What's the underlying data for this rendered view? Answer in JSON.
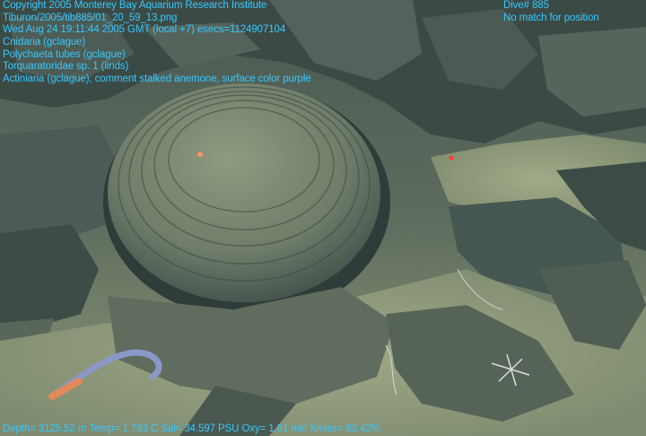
{
  "overlay": {
    "header_lines": [
      "Copyright 2005 Monterey Bay Aquarium Research Institute",
      "Tiburon/2005/tib885/01_20_59_13.png",
      "Wed Aug 24 19:11:44 2005 GMT (local +7) esecs=1124907104",
      "Cnidaria (gclague)",
      "Polychaeta tubes (gclague)",
      "Torquaratoridae sp. 1 (linds)",
      "Actiniaria (gclague); comment stalked anemone, surface color purple"
    ],
    "dive": "Dive# 885",
    "position_status": "No match for position",
    "telemetry": "Depth= 3125.52 m  Temp= 1.783 C  Sal= 34.597 PSU  Oxy= 1.91 ml/l  Xmiss= 83.42%"
  },
  "colors": {
    "overlay_text": "#36c8ff",
    "sediment": "#8a9676",
    "rock_dark": "#3b4a44",
    "laser_dot": "#ff3c3c"
  }
}
